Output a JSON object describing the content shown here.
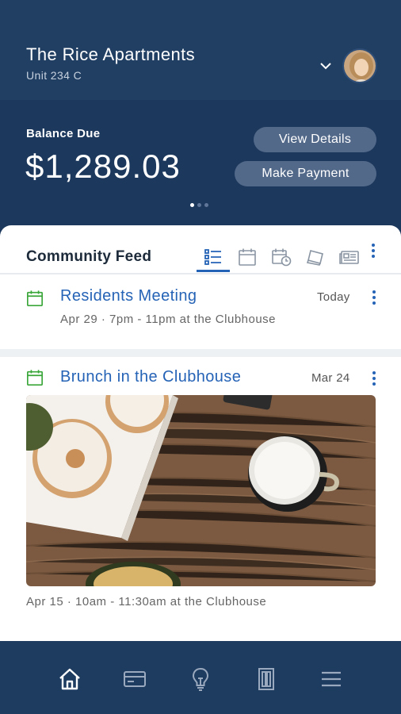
{
  "header": {
    "property_name": "The Rice Apartments",
    "unit": "Unit 234 C",
    "icons": {
      "chevron": "chevron-down-icon",
      "avatar": "user-avatar"
    }
  },
  "balance": {
    "label": "Balance Due",
    "amount": "$1,289.03",
    "view_details_label": "View Details",
    "make_payment_label": "Make Payment",
    "carousel_page": 1,
    "carousel_total": 3
  },
  "feed": {
    "title": "Community Feed",
    "tabs": [
      {
        "icon": "list-icon",
        "active": true
      },
      {
        "icon": "calendar-icon",
        "active": false
      },
      {
        "icon": "calendar-clock-icon",
        "active": false
      },
      {
        "icon": "stack-icon",
        "active": false
      },
      {
        "icon": "newspaper-icon",
        "active": false
      }
    ],
    "items": [
      {
        "icon": "calendar-icon",
        "title": "Residents Meeting",
        "date": "Today",
        "details": "Apr 29 · 7pm - 11pm at the Clubhouse"
      },
      {
        "icon": "calendar-icon",
        "title": "Brunch in the Clubhouse",
        "date": "Mar 24",
        "details": "Apr 15 · 10am - 11:30am at the Clubhouse"
      }
    ]
  },
  "bottom_nav": [
    {
      "icon": "home-icon",
      "active": true
    },
    {
      "icon": "credit-card-icon",
      "active": false
    },
    {
      "icon": "lightbulb-icon",
      "active": false
    },
    {
      "icon": "door-icon",
      "active": false
    },
    {
      "icon": "hamburger-menu-icon",
      "active": false
    }
  ],
  "colors": {
    "header_bg": "#213e63",
    "balance_bg": "#1c385c",
    "accent_blue": "#2563b6",
    "event_green": "#3aa63a",
    "nav_bg": "#1e3b60"
  }
}
